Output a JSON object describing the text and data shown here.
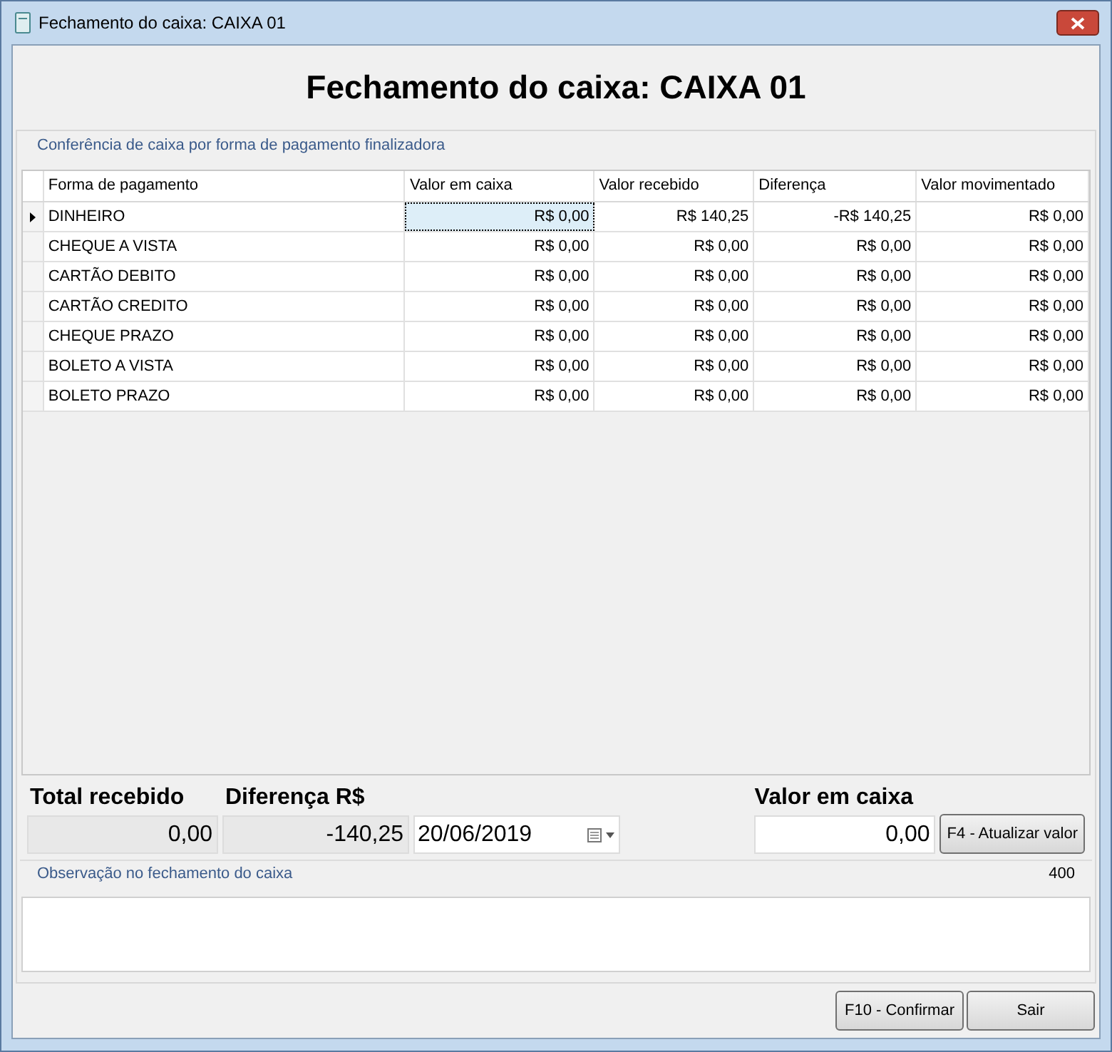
{
  "window": {
    "title": "Fechamento do caixa: CAIXA 01"
  },
  "heading": "Fechamento do caixa: CAIXA 01",
  "group": {
    "caption": "Conferência de caixa por forma de pagamento finalizadora"
  },
  "table": {
    "columns": [
      "Forma de pagamento",
      "Valor em caixa",
      "Valor recebido",
      "Diferença",
      "Valor movimentado"
    ],
    "rows": [
      {
        "cells": [
          "DINHEIRO",
          "R$ 0,00",
          "R$ 140,25",
          "-R$ 140,25",
          "R$ 0,00"
        ],
        "selected": true
      },
      {
        "cells": [
          "CHEQUE A VISTA",
          "R$ 0,00",
          "R$ 0,00",
          "R$ 0,00",
          "R$ 0,00"
        ],
        "selected": false
      },
      {
        "cells": [
          "CARTÃO DEBITO",
          "R$ 0,00",
          "R$ 0,00",
          "R$ 0,00",
          "R$ 0,00"
        ],
        "selected": false
      },
      {
        "cells": [
          "CARTÃO CREDITO",
          "R$ 0,00",
          "R$ 0,00",
          "R$ 0,00",
          "R$ 0,00"
        ],
        "selected": false
      },
      {
        "cells": [
          "CHEQUE PRAZO",
          "R$ 0,00",
          "R$ 0,00",
          "R$ 0,00",
          "R$ 0,00"
        ],
        "selected": false
      },
      {
        "cells": [
          "BOLETO A VISTA",
          "R$ 0,00",
          "R$ 0,00",
          "R$ 0,00",
          "R$ 0,00"
        ],
        "selected": false
      },
      {
        "cells": [
          "BOLETO PRAZO",
          "R$ 0,00",
          "R$ 0,00",
          "R$ 0,00",
          "R$ 0,00"
        ],
        "selected": false
      }
    ]
  },
  "summary": {
    "total_label": "Total recebido",
    "total_value": "0,00",
    "diff_label": "Diferença R$",
    "diff_value": "-140,25",
    "date": "20/06/2019",
    "cash_label": "Valor em caixa",
    "cash_value": "0,00",
    "update_button": "F4 - Atualizar valor"
  },
  "observation": {
    "caption": "Observação no fechamento do caixa",
    "counter": "400"
  },
  "buttons": [
    "F10 - Confirmar",
    "Sair"
  ]
}
